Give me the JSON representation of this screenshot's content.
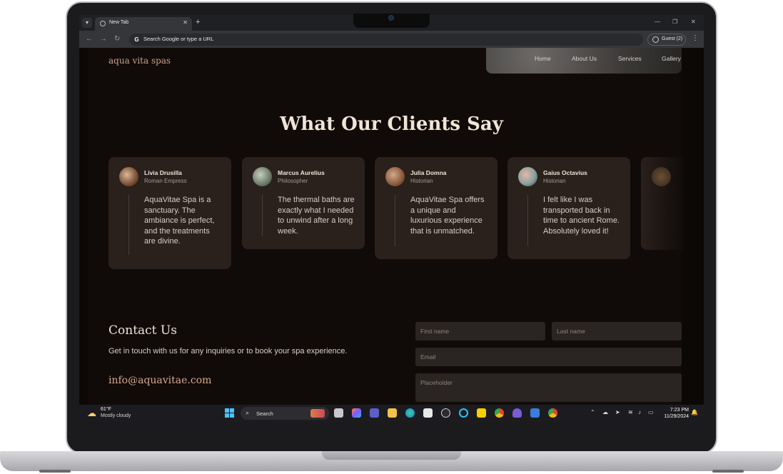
{
  "browser": {
    "tab_title": "New Tab",
    "omnibox_placeholder": "Search Google or type a URL",
    "profile_label": "Guest (2)"
  },
  "site": {
    "logo": "aqua vita spas",
    "nav": [
      "Home",
      "About Us",
      "Services",
      "Gallery"
    ]
  },
  "testimonials": {
    "heading": "What Our Clients Say",
    "items": [
      {
        "name": "Livia Drusilla",
        "role": "Roman Empress",
        "quote": "AquaVitae Spa is a sanctuary. The ambiance is perfect, and the treatments are divine."
      },
      {
        "name": "Marcus Aurelius",
        "role": "Philosopher",
        "quote": "The thermal baths are exactly what I needed to unwind after a long week."
      },
      {
        "name": "Julia Domna",
        "role": "Historian",
        "quote": "AquaVitae Spa offers a unique and luxurious experience that is unmatched."
      },
      {
        "name": "Gaius Octavius",
        "role": "Historian",
        "quote": "I felt like I was transported back in time to ancient Rome. Absolutely loved it!"
      }
    ]
  },
  "contact": {
    "heading": "Contact Us",
    "subtitle": "Get in touch with us for any inquiries or to book your spa experience.",
    "email": "info@aquavitae.com",
    "first_name_placeholder": "First name",
    "last_name_placeholder": "Last name",
    "email_placeholder": "Email",
    "message_placeholder": "Placeholder"
  },
  "taskbar": {
    "weather_temp": "61°F",
    "weather_condition": "Mostly cloudy",
    "search_label": "Search",
    "time": "7:23 PM",
    "date": "11/29/2024"
  },
  "colors": {
    "page_background": "#100b09",
    "card_background": "#2a201c",
    "accent": "#d6a98f"
  }
}
